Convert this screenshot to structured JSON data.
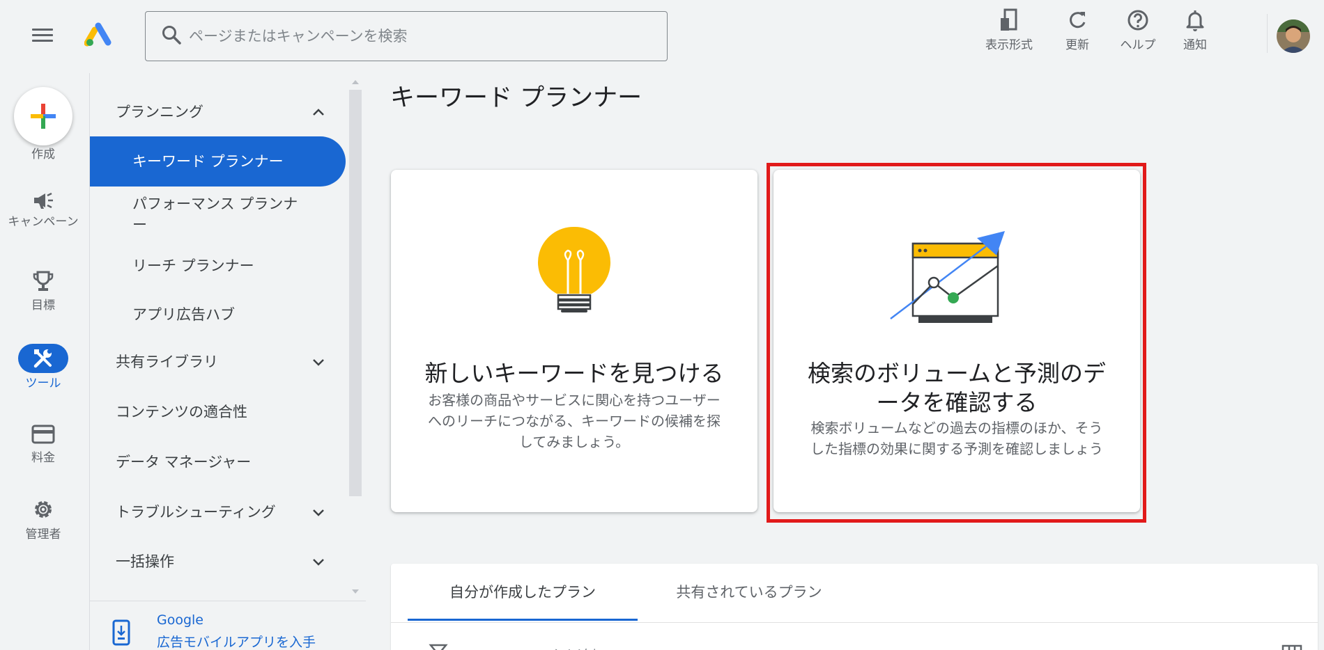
{
  "header": {
    "search_placeholder": "ページまたはキャンペーンを検索",
    "actions": [
      {
        "label": "表示形式",
        "icon": "appearance-icon"
      },
      {
        "label": "更新",
        "icon": "refresh-icon"
      },
      {
        "label": "ヘルプ",
        "icon": "help-icon"
      },
      {
        "label": "通知",
        "icon": "bell-icon"
      }
    ]
  },
  "rail": {
    "create_label": "作成",
    "campaigns_label": "キャンペーン",
    "goals_label": "目標",
    "tools_label": "ツール",
    "billing_label": "料金",
    "admin_label": "管理者"
  },
  "nav": {
    "planning": "プランニング",
    "keyword_planner": "キーワード プランナー",
    "performance_planner_line1": "パフォーマンス プランナ",
    "performance_planner_line2": "ー",
    "reach_planner": "リーチ プランナー",
    "app_ads_hub": "アプリ広告ハブ",
    "shared_library": "共有ライブラリ",
    "content_suitability": "コンテンツの適合性",
    "data_manager": "データ マネージャー",
    "troubleshooting": "トラブルシューティング",
    "bulk_actions": "一括操作",
    "mobile_app_line1": "Google",
    "mobile_app_line2": "広告モバイルアプリを入手"
  },
  "main": {
    "page_title": "キーワード プランナー",
    "card1": {
      "title": "新しいキーワードを見つける",
      "desc_line1": "お客様の商品やサービスに関心を持つユーザー",
      "desc_line2": "へのリーチにつながる、キーワードの候補を探",
      "desc_line3": "してみましょう。"
    },
    "card2": {
      "title_line1": "検索のボリュームと予測のデ",
      "title_line2": "ータを確認する",
      "desc_line1": "検索ボリュームなどの過去の指標のほか、そう",
      "desc_line2": "した指標の効果に関する予測を確認しましょう"
    },
    "tabs": [
      "自分が作成したプラン",
      "共有されているプラン"
    ],
    "filter_placeholder": "フィルタを追加"
  },
  "colors": {
    "accent": "#1967d2",
    "highlight": "#e11a1a",
    "bulb": "#fbbc04",
    "chart_arrow": "#4285f4",
    "chart_point": "#34a853"
  }
}
